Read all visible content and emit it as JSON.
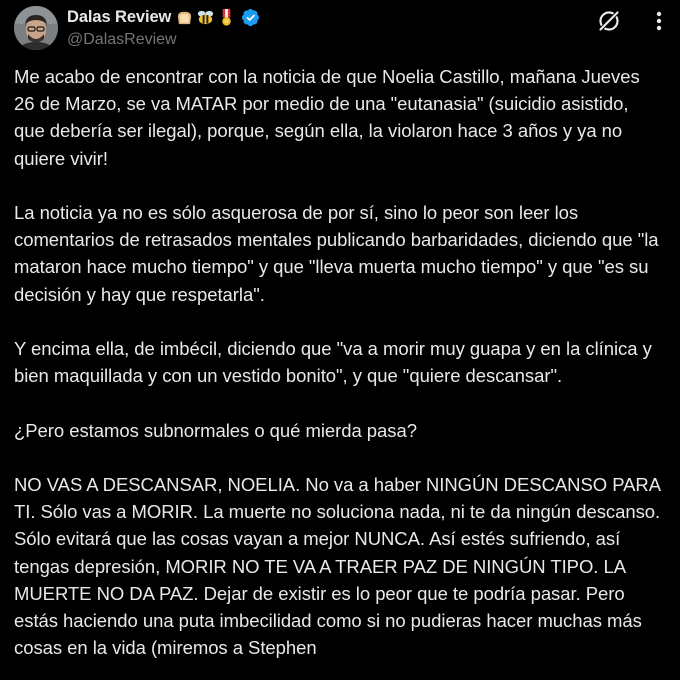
{
  "author": {
    "display_name": "Dalas Review",
    "handle": "@DalasReview",
    "badges": [
      "bread-emoji",
      "bee-emoji",
      "medal-emoji"
    ],
    "verified_icon": "verified-badge-icon",
    "verified_color": "#1d9bf0"
  },
  "actions": {
    "grok_icon": "grok-icon",
    "more_icon": "more-options-icon"
  },
  "tweet": {
    "paragraphs": [
      "Me acabo de encontrar con la noticia de que Noelia Castillo, mañana Jueves 26 de Marzo, se va MATAR por medio de una \"eutanasia\" (suicidio asistido, que debería ser ilegal), porque, según ella, la violaron hace 3 años y ya no quiere vivir!",
      "La noticia ya no es sólo asquerosa de por sí, sino lo peor son leer los comentarios de retrasados mentales publicando barbaridades, diciendo que \"la mataron hace mucho tiempo\" y que \"lleva muerta mucho tiempo\" y que \"es su decisión y hay que respetarla\".",
      "Y encima ella, de imbécil, diciendo que \"va a morir muy guapa y en la clínica y bien maquillada y con un vestido bonito\", y que \"quiere descansar\".",
      "¿Pero estamos subnormales o qué mierda pasa?",
      "NO VAS A DESCANSAR, NOELIA. No va a haber NINGÚN DESCANSO PARA TI. Sólo vas a MORIR. La muerte no soluciona nada, ni te da ningún descanso. Sólo evitará que las cosas vayan a mejor NUNCA. Así estés sufriendo, así tengas depresión, MORIR NO TE VA A TRAER PAZ DE NINGÚN TIPO. LA MUERTE NO DA PAZ. Dejar de existir es lo peor que te podría pasar. Pero estás haciendo una puta imbecilidad como si no pudieras hacer muchas más cosas en la vida (miremos a Stephen"
    ]
  },
  "colors": {
    "background": "#000000",
    "text": "#e7e9ea",
    "secondary_text": "#71767b"
  }
}
